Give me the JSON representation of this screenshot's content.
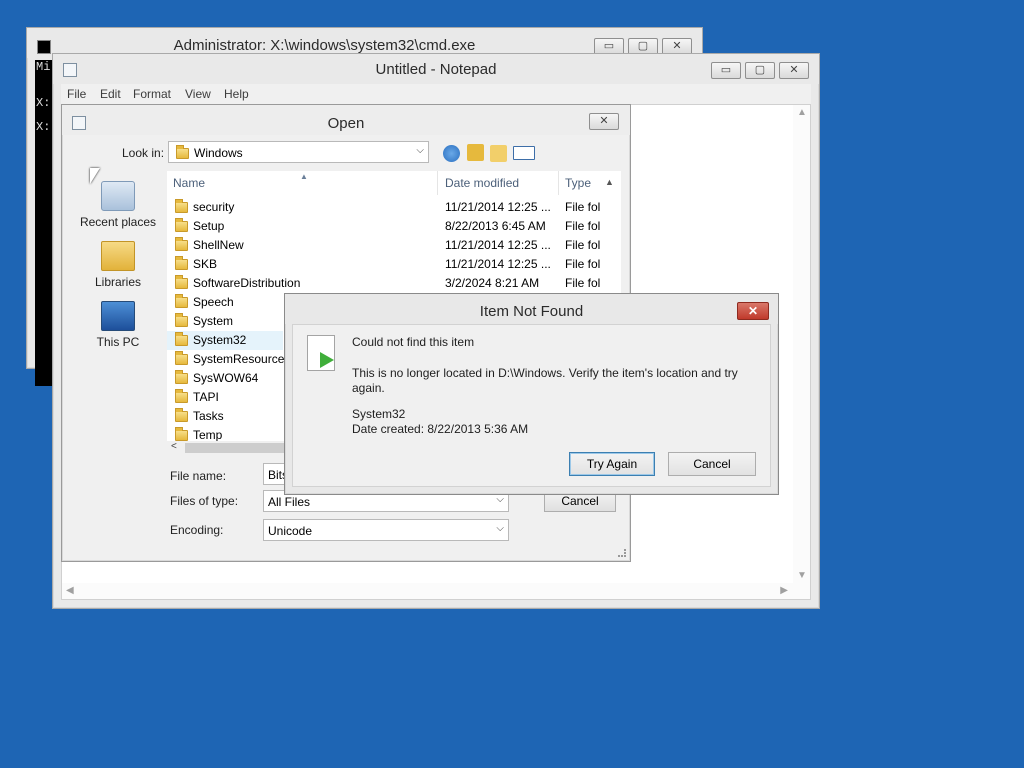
{
  "cmd": {
    "title": "Administrator: X:\\windows\\system32\\cmd.exe",
    "lines": [
      "Mi",
      "X:",
      "X:"
    ],
    "min": "▭",
    "max": "▢",
    "close": "✕"
  },
  "notepad": {
    "title": "Untitled - Notepad",
    "menu": [
      "File",
      "Edit",
      "Format",
      "View",
      "Help"
    ],
    "min": "▭",
    "max": "▢",
    "close": "✕"
  },
  "open_dialog": {
    "title": "Open",
    "close": "✕",
    "look_in_label": "Look in:",
    "look_in_value": "Windows",
    "places": [
      "Recent places",
      "Libraries",
      "This PC"
    ],
    "columns": [
      "Name",
      "Date modified",
      "Type"
    ],
    "files": [
      {
        "name": "security",
        "date": "11/21/2014 12:25 ...",
        "type": "File fol"
      },
      {
        "name": "Setup",
        "date": "8/22/2013 6:45 AM",
        "type": "File fol"
      },
      {
        "name": "ShellNew",
        "date": "11/21/2014 12:25 ...",
        "type": "File fol"
      },
      {
        "name": "SKB",
        "date": "11/21/2014 12:25 ...",
        "type": "File fol"
      },
      {
        "name": "SoftwareDistribution",
        "date": "3/2/2024 8:21 AM",
        "type": "File fol"
      },
      {
        "name": "Speech",
        "date": "",
        "type": ""
      },
      {
        "name": "System",
        "date": "",
        "type": ""
      },
      {
        "name": "System32",
        "date": "",
        "type": ""
      },
      {
        "name": "SystemResources",
        "date": "",
        "type": ""
      },
      {
        "name": "SysWOW64",
        "date": "",
        "type": ""
      },
      {
        "name": "TAPI",
        "date": "",
        "type": ""
      },
      {
        "name": "Tasks",
        "date": "",
        "type": ""
      },
      {
        "name": "Temp",
        "date": "",
        "type": ""
      }
    ],
    "file_name_label": "File name:",
    "file_name_value": "Bits",
    "files_of_type_label": "Files of type:",
    "files_of_type_value": "All Files",
    "encoding_label": "Encoding:",
    "encoding_value": "Unicode",
    "cancel": "Cancel"
  },
  "not_found": {
    "title": "Item Not Found",
    "close": "✕",
    "heading": "Could not find this item",
    "message_1": "This is no longer located in D:\\Windows. Verify the item's location and try",
    "message_2": "again.",
    "item_name": "System32",
    "item_date": "Date created: 8/22/2013 5:36 AM",
    "try_again": "Try Again",
    "cancel": "Cancel"
  },
  "colors": {
    "desktop": "#1e65b4",
    "close_red": "#c0392b",
    "folder": "#e6b93d"
  }
}
